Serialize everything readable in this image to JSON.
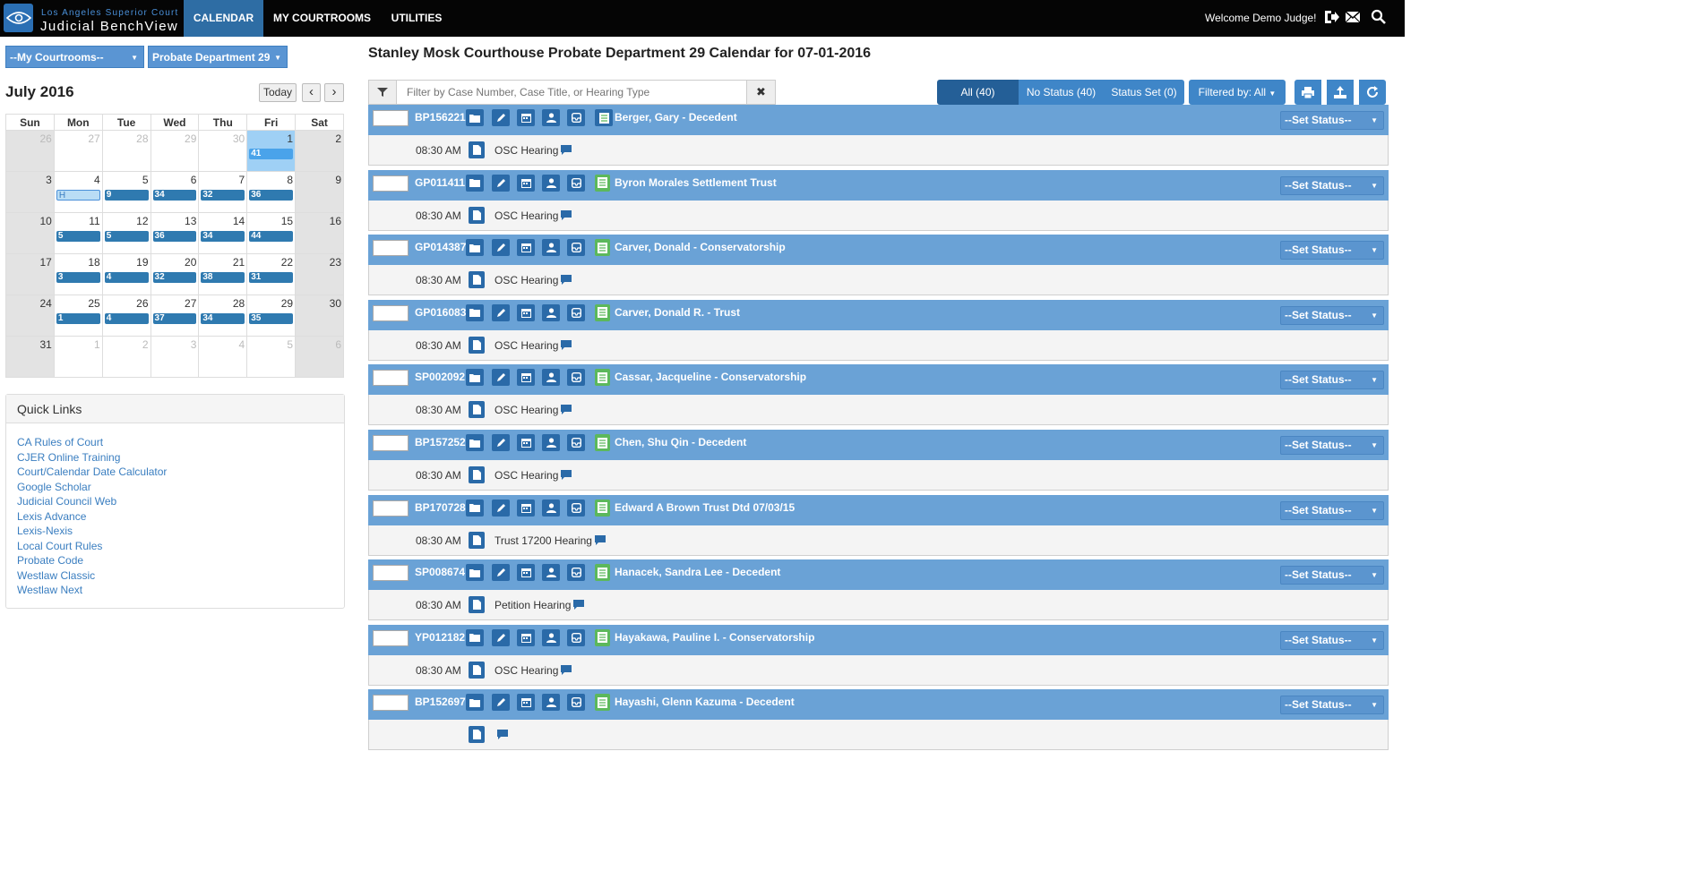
{
  "brand": {
    "subtitle": "Los Angeles Superior Court",
    "title": "Judicial BenchView"
  },
  "nav": [
    {
      "label": "CALENDAR"
    },
    {
      "label": "MY COURTROOMS"
    },
    {
      "label": "UTILITIES"
    }
  ],
  "user": {
    "welcome": "Welcome Demo Judge!"
  },
  "selectors": {
    "courtrooms": "--My Courtrooms--",
    "department": "Probate Department 29"
  },
  "calendar": {
    "month": "July 2016",
    "today_label": "Today",
    "prev_icon": "‹",
    "next_icon": "›",
    "weekdays": [
      "Sun",
      "Mon",
      "Tue",
      "Wed",
      "Thu",
      "Fri",
      "Sat"
    ],
    "weeks": [
      [
        {
          "d": "26"
        },
        {
          "d": "27"
        },
        {
          "d": "28"
        },
        {
          "d": "29"
        },
        {
          "d": "30"
        },
        {
          "d": "1",
          "b": "41"
        },
        {
          "d": "2"
        }
      ],
      [
        {
          "d": "3"
        },
        {
          "d": "4",
          "b": "H"
        },
        {
          "d": "5",
          "b": "9"
        },
        {
          "d": "6",
          "b": "34"
        },
        {
          "d": "7",
          "b": "32"
        },
        {
          "d": "8",
          "b": "36"
        },
        {
          "d": "9"
        }
      ],
      [
        {
          "d": "10"
        },
        {
          "d": "11",
          "b": "5"
        },
        {
          "d": "12",
          "b": "5"
        },
        {
          "d": "13",
          "b": "36"
        },
        {
          "d": "14",
          "b": "34"
        },
        {
          "d": "15",
          "b": "44"
        },
        {
          "d": "16"
        }
      ],
      [
        {
          "d": "17"
        },
        {
          "d": "18",
          "b": "3"
        },
        {
          "d": "19",
          "b": "4"
        },
        {
          "d": "20",
          "b": "32"
        },
        {
          "d": "21",
          "b": "38"
        },
        {
          "d": "22",
          "b": "31"
        },
        {
          "d": "23"
        }
      ],
      [
        {
          "d": "24"
        },
        {
          "d": "25",
          "b": "1"
        },
        {
          "d": "26",
          "b": "4"
        },
        {
          "d": "27",
          "b": "37"
        },
        {
          "d": "28",
          "b": "34"
        },
        {
          "d": "29",
          "b": "35"
        },
        {
          "d": "30"
        }
      ],
      [
        {
          "d": "31"
        },
        {
          "d": "1"
        },
        {
          "d": "2"
        },
        {
          "d": "3"
        },
        {
          "d": "4"
        },
        {
          "d": "5"
        },
        {
          "d": "6"
        }
      ]
    ]
  },
  "quick_links": {
    "title": "Quick Links",
    "items": [
      "CA Rules of Court",
      "CJER Online Training",
      "Court/Calendar Date Calculator",
      "Google Scholar",
      "Judicial Council Web",
      "Lexis Advance",
      "Lexis-Nexis",
      "Local Court Rules",
      "Probate Code",
      "Westlaw Classic",
      "Westlaw Next"
    ]
  },
  "main": {
    "title": "Stanley Mosk Courthouse Probate Department 29 Calendar for 07-01-2016",
    "filter_placeholder": "Filter by Case Number, Case Title, or Hearing Type",
    "filter_clear": "✖",
    "status_tabs": {
      "all": "All (40)",
      "no_status": "No Status (40)",
      "status_set": "Status Set (0)"
    },
    "filtered_by": "Filtered by: All",
    "set_status_label": "--Set Status--",
    "cases": [
      {
        "num": "BP156221",
        "title": "Berger, Gary - Decedent",
        "time": "08:30 AM",
        "hearing": "OSC Hearing"
      },
      {
        "num": "GP011411",
        "title": "Byron Morales Settlement Trust",
        "time": "08:30 AM",
        "hearing": "OSC Hearing"
      },
      {
        "num": "GP014387",
        "title": "Carver, Donald - Conservatorship",
        "time": "08:30 AM",
        "hearing": "OSC Hearing"
      },
      {
        "num": "GP016083",
        "title": "Carver, Donald R. - Trust",
        "time": "08:30 AM",
        "hearing": "OSC Hearing"
      },
      {
        "num": "SP002092",
        "title": "Cassar, Jacqueline - Conservatorship",
        "time": "08:30 AM",
        "hearing": "OSC Hearing"
      },
      {
        "num": "BP157252",
        "title": "Chen, Shu Qin - Decedent",
        "time": "08:30 AM",
        "hearing": "OSC Hearing"
      },
      {
        "num": "BP170728",
        "title": "Edward A Brown Trust Dtd 07/03/15",
        "time": "08:30 AM",
        "hearing": "Trust 17200 Hearing"
      },
      {
        "num": "SP008674",
        "title": "Hanacek, Sandra Lee - Decedent",
        "time": "08:30 AM",
        "hearing": "Petition Hearing"
      },
      {
        "num": "YP012182",
        "title": "Hayakawa, Pauline I. - Conservatorship",
        "time": "08:30 AM",
        "hearing": "OSC Hearing"
      },
      {
        "num": "BP152697",
        "title": "Hayashi, Glenn Kazuma - Decedent",
        "time": "",
        "hearing": ""
      }
    ]
  }
}
